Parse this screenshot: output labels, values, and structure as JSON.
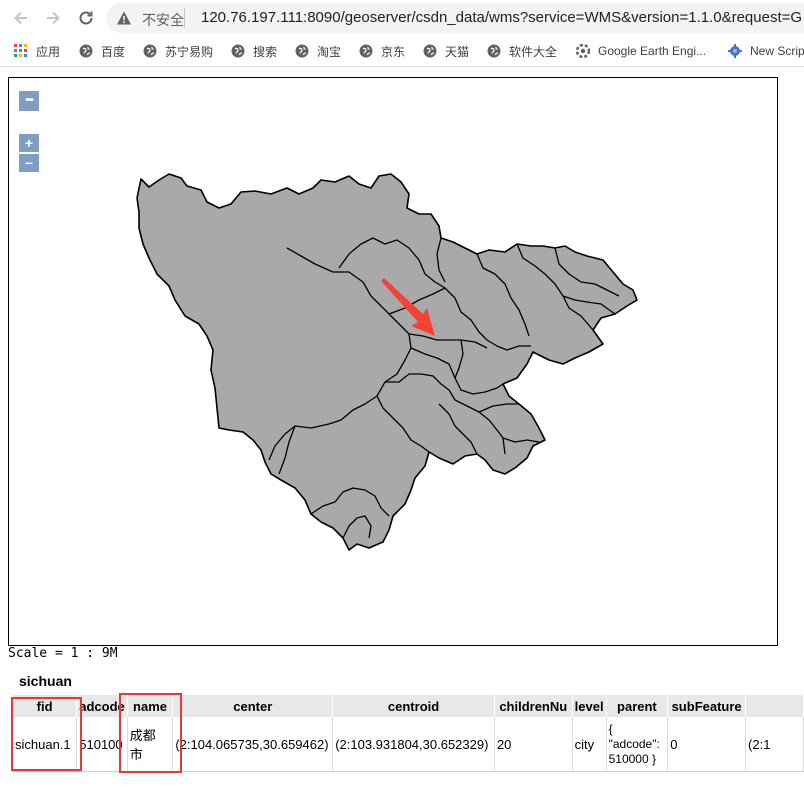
{
  "browser": {
    "security_label": "不安全",
    "url": "120.76.197.111:8090/geoserver/csdn_data/wms?service=WMS&version=1.1.0&request=G",
    "bookmarks": [
      {
        "label": "应用",
        "icon": "apps-grid-icon"
      },
      {
        "label": "百度",
        "icon": "globe-icon"
      },
      {
        "label": "苏宁易购",
        "icon": "globe-icon"
      },
      {
        "label": "搜索",
        "icon": "globe-icon"
      },
      {
        "label": "淘宝",
        "icon": "globe-icon"
      },
      {
        "label": "京东",
        "icon": "globe-icon"
      },
      {
        "label": "天猫",
        "icon": "globe-icon"
      },
      {
        "label": "软件大全",
        "icon": "globe-icon"
      },
      {
        "label": "Google Earth Engi...",
        "icon": "earth-engine-icon"
      },
      {
        "label": "New Scrip",
        "icon": "script-icon"
      }
    ]
  },
  "map": {
    "controls": {
      "menu": "•••",
      "zoom_in": "+",
      "zoom_out": "−"
    },
    "fill_color": "#a9a9a9",
    "border_color": "#000000",
    "arrow_color": "#f44336",
    "scale": "Scale = 1 : 9M"
  },
  "feature_info": {
    "layer": "sichuan",
    "columns": [
      "fid",
      "adcode",
      "name",
      "center",
      "centroid",
      "childrenNu",
      "level",
      "parent",
      "subFeature",
      ""
    ],
    "row": [
      "sichuan.1",
      "510100",
      "成都\n市",
      "(2:104.065735,30.659462)",
      "(2:103.931804,30.652329)",
      "20",
      "city",
      "{\n\"adcode\":\n510000 }",
      "0",
      "(2:1"
    ],
    "highlight_color": "#e53935"
  }
}
